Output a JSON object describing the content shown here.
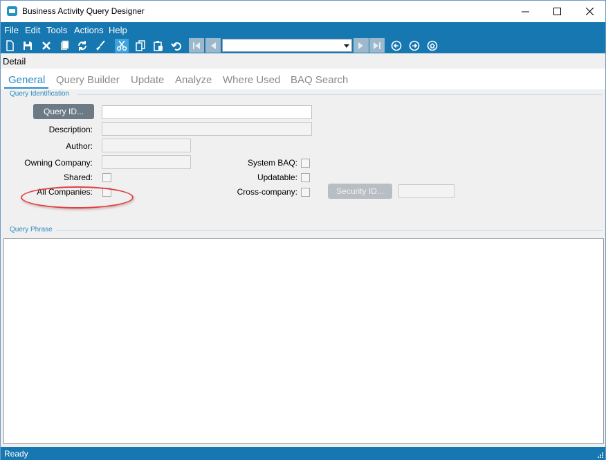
{
  "window": {
    "title": "Business Activity Query Designer",
    "minimize_glyph": "—",
    "maximize_glyph": "☐",
    "close_glyph": "✕"
  },
  "menu": {
    "items": [
      "File",
      "Edit",
      "Tools",
      "Actions",
      "Help"
    ]
  },
  "toolbar": {
    "icons": [
      "new-icon",
      "save-icon",
      "delete-icon",
      "clear-icon",
      "refresh-icon",
      "brush-icon",
      "cut-icon",
      "copy-icon",
      "paste-icon",
      "undo-icon"
    ],
    "navigation_value": "",
    "nav_icons": [
      "back-circle-icon",
      "forward-circle-icon",
      "home-circle-icon"
    ]
  },
  "detail": {
    "label": "Detail"
  },
  "tabs": [
    {
      "label": "General",
      "active": true
    },
    {
      "label": "Query Builder",
      "active": false
    },
    {
      "label": "Update",
      "active": false
    },
    {
      "label": "Analyze",
      "active": false
    },
    {
      "label": "Where Used",
      "active": false
    },
    {
      "label": "BAQ Search",
      "active": false
    }
  ],
  "query_identification": {
    "group_label": "Query Identification",
    "query_id_button": "Query ID...",
    "query_id_value": "",
    "description_label": "Description:",
    "description_value": "",
    "author_label": "Author:",
    "author_value": "",
    "owning_company_label": "Owning Company:",
    "owning_company_value": "",
    "shared_label": "Shared:",
    "shared_checked": false,
    "all_companies_label": "All Companies:",
    "all_companies_checked": false,
    "system_baq_label": "System BAQ:",
    "system_baq_checked": false,
    "updatable_label": "Updatable:",
    "updatable_checked": false,
    "cross_company_label": "Cross-company:",
    "cross_company_checked": false,
    "security_id_button": "Security ID...",
    "security_id_value": ""
  },
  "query_phrase": {
    "group_label": "Query Phrase",
    "value": ""
  },
  "status": {
    "text": "Ready"
  },
  "colors": {
    "accent": "#1777b0",
    "tab_active": "#2b8ac2",
    "annotation": "#e04040"
  }
}
